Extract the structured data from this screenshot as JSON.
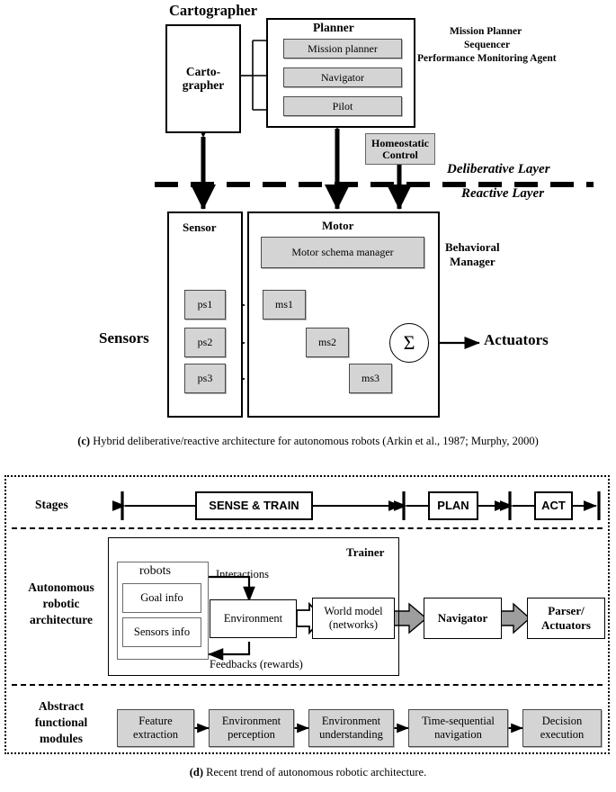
{
  "figure_c": {
    "title_cartographer": "Cartographer",
    "cartographer_box": "Carto-\ngrapher",
    "planner_title": "Planner",
    "planner_items": [
      "Mission planner",
      "Navigator",
      "Pilot"
    ],
    "right_note": [
      "Mission Planner",
      "Sequencer",
      "Performance Monitoring Agent"
    ],
    "homeostatic": "Homeostatic\nControl",
    "layer_upper": "Deliberative Layer",
    "layer_lower": "Reactive Layer",
    "sensor_title": "Sensor",
    "sensor_items": [
      "ps1",
      "ps2",
      "ps3"
    ],
    "motor_title": "Motor",
    "motor_schema_manager": "Motor schema manager",
    "motor_items": [
      "ms1",
      "ms2",
      "ms3"
    ],
    "summation_symbol": "Σ",
    "behavioral_manager": "Behavioral\nManager",
    "sensors_label": "Sensors",
    "actuators_label": "Actuators",
    "caption_bold": "(c)",
    "caption_text": " Hybrid deliberative/reactive architecture for autonomous robots (Arkin et al., 1987; Murphy, 2000)"
  },
  "figure_d": {
    "row_labels": {
      "stages": "Stages",
      "architecture": "Autonomous\nrobotic\narchitecture",
      "modules": "Abstract\nfunctional\nmodules"
    },
    "stages": [
      "SENSE & TRAIN",
      "PLAN",
      "ACT"
    ],
    "architecture": {
      "trainer_label": "Trainer",
      "robots_label": "robots",
      "robots_items": [
        "Goal info",
        "Sensors info"
      ],
      "environment": "Environment",
      "world_model": "World model\n(networks)",
      "navigator": "Navigator",
      "parser_actuators": "Parser/\nActuators",
      "arrow_label_top": "Interactions",
      "arrow_label_bottom": "Feedbacks (rewards)"
    },
    "modules": [
      "Feature\nextraction",
      "Environment\nperception",
      "Environment\nunderstanding",
      "Time-sequential\nnavigation",
      "Decision\nexecution"
    ],
    "caption_bold": "(d)",
    "caption_text": " Recent trend of autonomous robotic architecture."
  },
  "colors": {
    "gray_fill": "#d4d4d4",
    "stroke": "#000000"
  }
}
